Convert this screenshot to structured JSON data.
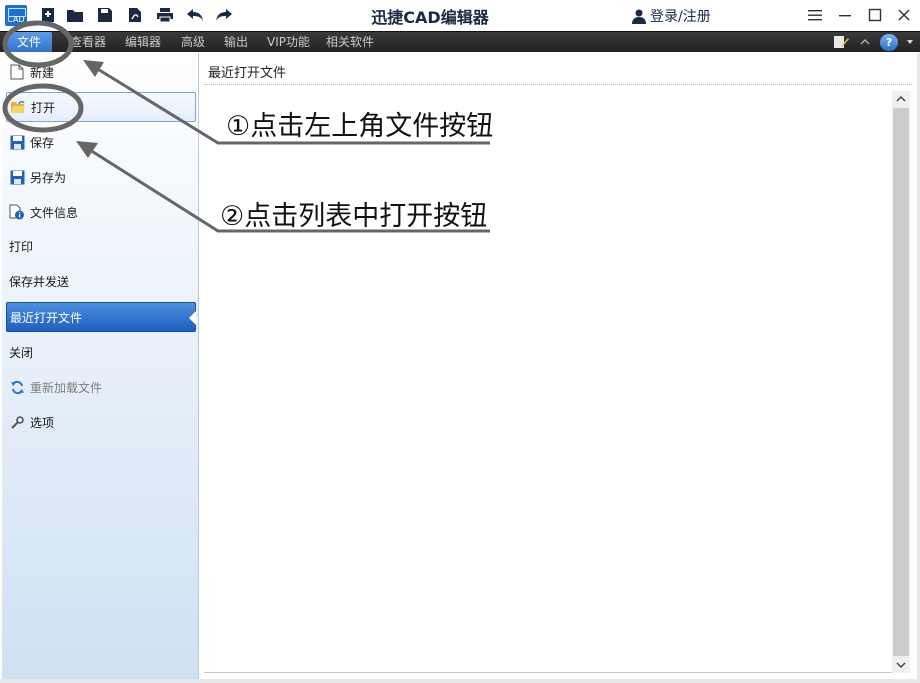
{
  "app": {
    "logo_text": "CAD",
    "title": "迅捷CAD编辑器",
    "login": "登录/注册"
  },
  "quick_access": [
    "add-file-icon",
    "folder-icon",
    "save-icon",
    "pdf-icon",
    "print-icon",
    "undo-icon",
    "redo-icon"
  ],
  "ribbon_tabs": [
    {
      "label": "文件",
      "active": true
    },
    {
      "label": "查看器"
    },
    {
      "label": "编辑器"
    },
    {
      "label": "高级"
    },
    {
      "label": "输出"
    },
    {
      "label": "VIP功能"
    },
    {
      "label": "相关软件"
    }
  ],
  "ribbon_right": {
    "help_label": "?"
  },
  "sidebar": {
    "items": [
      {
        "label": "新建",
        "icon": "new-file-icon"
      },
      {
        "label": "打开",
        "icon": "open-folder-icon",
        "state": "outlined"
      },
      {
        "label": "保存",
        "icon": "save-icon"
      },
      {
        "label": "另存为",
        "icon": "save-as-icon"
      },
      {
        "label": "文件信息",
        "icon": "file-info-icon"
      },
      {
        "label": "打印"
      },
      {
        "label": "保存并发送"
      },
      {
        "label": "最近打开文件",
        "state": "selected"
      },
      {
        "label": "关闭"
      },
      {
        "label": "重新加载文件",
        "icon": "reload-icon",
        "state": "disabled"
      },
      {
        "label": "选项",
        "icon": "wrench-icon"
      }
    ]
  },
  "main": {
    "title": "最近打开文件"
  },
  "annotations": {
    "step1": "①点击左上角文件按钮",
    "step2": "②点击列表中打开按钮"
  },
  "colors": {
    "accent_blue": "#2f73c8",
    "ribbon_bg": "#2a2a2a",
    "annotation_gray": "#6b6b6b"
  }
}
